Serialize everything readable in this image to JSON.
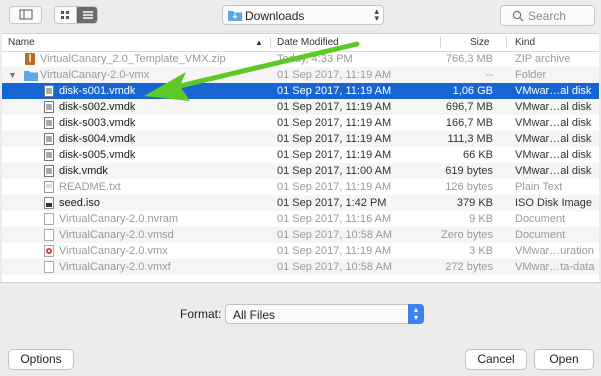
{
  "toolbar": {
    "location": "Downloads",
    "search_placeholder": "Search"
  },
  "columns": {
    "name": "Name",
    "date": "Date Modified",
    "size": "Size",
    "kind": "Kind"
  },
  "files": [
    {
      "name": "VirtualCanary_2.0_Template_VMX.zip",
      "date": "Today, 4:33 PM",
      "size": "766,3 MB",
      "kind": "ZIP archive",
      "icon": "zip-archive-icon",
      "indent": 0
    },
    {
      "name": "VirtualCanary-2.0-vmx",
      "date": "01 Sep 2017, 11:19 AM",
      "size": "--",
      "kind": "Folder",
      "icon": "folder-icon",
      "indent": 0
    },
    {
      "name": "disk-s001.vmdk",
      "date": "01 Sep 2017, 11:19 AM",
      "size": "1,06 GB",
      "kind": "VMwar…al disk",
      "icon": "vmdk-file-icon",
      "indent": 1
    },
    {
      "name": "disk-s002.vmdk",
      "date": "01 Sep 2017, 11:19 AM",
      "size": "696,7 MB",
      "kind": "VMwar…al disk",
      "icon": "vmdk-file-icon",
      "indent": 1
    },
    {
      "name": "disk-s003.vmdk",
      "date": "01 Sep 2017, 11:19 AM",
      "size": "166,7 MB",
      "kind": "VMwar…al disk",
      "icon": "vmdk-file-icon",
      "indent": 1
    },
    {
      "name": "disk-s004.vmdk",
      "date": "01 Sep 2017, 11:19 AM",
      "size": "111,3 MB",
      "kind": "VMwar…al disk",
      "icon": "vmdk-file-icon",
      "indent": 1
    },
    {
      "name": "disk-s005.vmdk",
      "date": "01 Sep 2017, 11:19 AM",
      "size": "66 KB",
      "kind": "VMwar…al disk",
      "icon": "vmdk-file-icon",
      "indent": 1
    },
    {
      "name": "disk.vmdk",
      "date": "01 Sep 2017, 11:00 AM",
      "size": "619 bytes",
      "kind": "VMwar…al disk",
      "icon": "vmdk-file-icon",
      "indent": 1
    },
    {
      "name": "README.txt",
      "date": "01 Sep 2017, 11:19 AM",
      "size": "126 bytes",
      "kind": "Plain Text",
      "icon": "text-file-icon",
      "indent": 1
    },
    {
      "name": "seed.iso",
      "date": "01 Sep 2017, 1:42 PM",
      "size": "379 KB",
      "kind": "ISO Disk Image",
      "icon": "disk-image-icon",
      "indent": 1
    },
    {
      "name": "VirtualCanary-2.0.nvram",
      "date": "01 Sep 2017, 11:16 AM",
      "size": "9 KB",
      "kind": "Document",
      "icon": "document-icon",
      "indent": 1
    },
    {
      "name": "VirtualCanary-2.0.vmsd",
      "date": "01 Sep 2017, 10:58 AM",
      "size": "Zero bytes",
      "kind": "Document",
      "icon": "document-icon",
      "indent": 1
    },
    {
      "name": "VirtualCanary-2.0.vmx",
      "date": "01 Sep 2017, 11:19 AM",
      "size": "3 KB",
      "kind": "VMwar…uration",
      "icon": "vmx-config-icon",
      "indent": 1
    },
    {
      "name": "VirtualCanary-2.0.vmxf",
      "date": "01 Sep 2017, 10:58 AM",
      "size": "272 bytes",
      "kind": "VMwar…ta-data",
      "icon": "document-icon",
      "indent": 1
    }
  ],
  "selected_index": 2,
  "dimmed_indices": [
    0,
    1,
    8,
    10,
    11,
    12,
    13
  ],
  "format": {
    "label": "Format:",
    "value": "All Files"
  },
  "buttons": {
    "options": "Options",
    "cancel": "Cancel",
    "open": "Open"
  },
  "colors": {
    "selection": "#1765d3",
    "annotation_arrow": "#5ec826",
    "stepper": "#3b82f0"
  }
}
